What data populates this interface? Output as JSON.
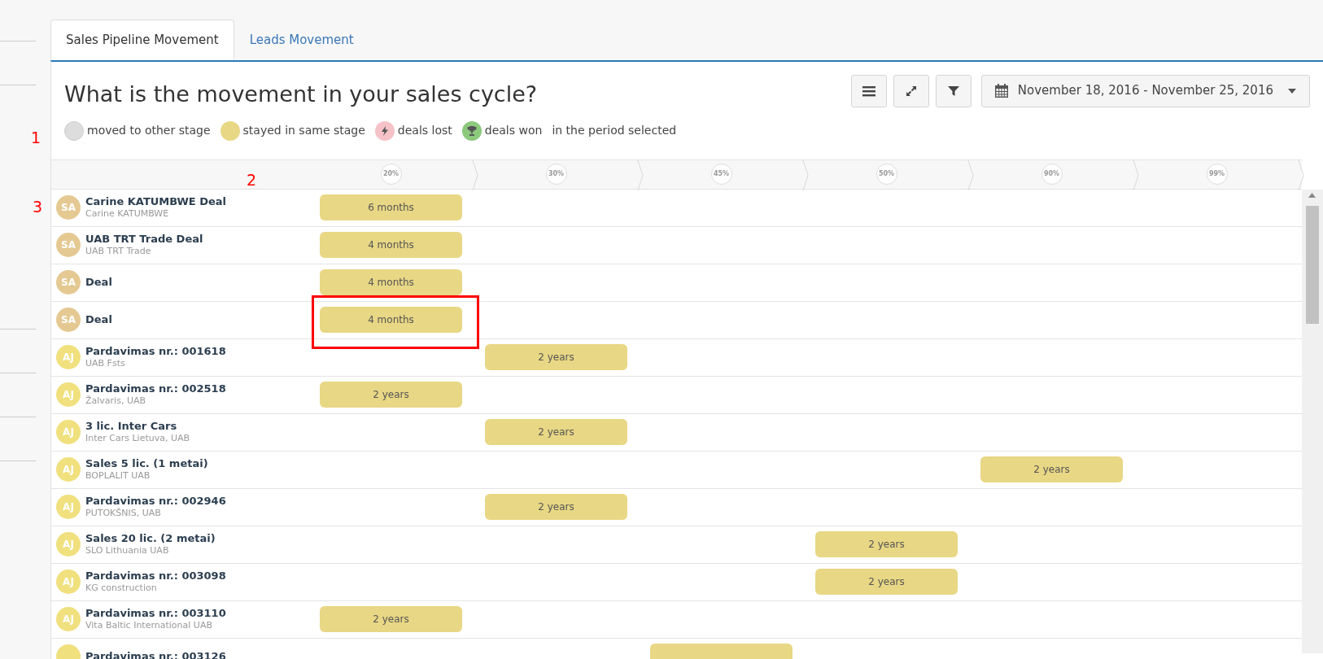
{
  "tabs": [
    {
      "label": "Sales Pipeline Movement",
      "selected": true
    },
    {
      "label": "Leads Movement",
      "selected": false
    }
  ],
  "title": "What is the movement in your sales cycle?",
  "toolbar": {
    "buttons": [
      {
        "kind": "menu"
      },
      {
        "kind": "expand"
      },
      {
        "kind": "filter"
      }
    ],
    "date_range": "November 18, 2016 - November 25, 2016"
  },
  "legend": {
    "items": [
      {
        "kind": "moved",
        "label": "moved to other stage",
        "color": "#dddddd"
      },
      {
        "kind": "stayed",
        "label": "stayed in same stage",
        "color": "#e8d784"
      },
      {
        "kind": "lost",
        "label": "deals lost",
        "color": "#f5c2c7"
      },
      {
        "kind": "won",
        "label": "deals won",
        "color": "#8cc97c"
      }
    ],
    "suffix": "in the period selected"
  },
  "annotations": [
    "1",
    "2",
    "3"
  ],
  "stages": [
    "20%",
    "30%",
    "45%",
    "50%",
    "90%",
    "99%"
  ],
  "rows": [
    {
      "initials": "SA",
      "color": "#e5c992",
      "name": "Carine KATUMBWE Deal",
      "company": "Carine KATUMBWE",
      "highlighted": false,
      "cells": [
        {
          "kind": "stayed",
          "duration": "6 months"
        },
        {
          "kind": "empty"
        },
        {
          "kind": "empty"
        },
        {
          "kind": "empty"
        },
        {
          "kind": "empty"
        },
        {
          "kind": "empty"
        }
      ]
    },
    {
      "initials": "SA",
      "color": "#e5c992",
      "name": "UAB TRT Trade Deal",
      "company": "UAB TRT Trade",
      "highlighted": false,
      "cells": [
        {
          "kind": "stayed",
          "duration": "4 months"
        },
        {
          "kind": "empty"
        },
        {
          "kind": "empty"
        },
        {
          "kind": "empty"
        },
        {
          "kind": "empty"
        },
        {
          "kind": "empty"
        }
      ]
    },
    {
      "initials": "SA",
      "color": "#e5c992",
      "name": "Deal",
      "highlighted": false,
      "cells": [
        {
          "kind": "stayed",
          "duration": "4 months"
        },
        {
          "kind": "empty"
        },
        {
          "kind": "empty"
        },
        {
          "kind": "empty"
        },
        {
          "kind": "empty"
        },
        {
          "kind": "empty"
        }
      ]
    },
    {
      "initials": "SA",
      "color": "#e5c992",
      "name": "Deal",
      "highlighted": true,
      "cells": [
        {
          "kind": "stayed",
          "duration": "4 months"
        },
        {
          "kind": "empty"
        },
        {
          "kind": "empty"
        },
        {
          "kind": "empty"
        },
        {
          "kind": "empty"
        },
        {
          "kind": "empty"
        }
      ]
    },
    {
      "initials": "AJ",
      "color": "#f0e07e",
      "name": "Pardavimas nr.: 001618",
      "company": "UAB Fsts",
      "highlighted": false,
      "cells": [
        {
          "kind": "empty"
        },
        {
          "kind": "stayed",
          "duration": "2 years"
        },
        {
          "kind": "empty"
        },
        {
          "kind": "empty"
        },
        {
          "kind": "empty"
        },
        {
          "kind": "empty"
        }
      ]
    },
    {
      "initials": "AJ",
      "color": "#f0e07e",
      "name": "Pardavimas nr.: 002518",
      "company": "Žalvaris, UAB",
      "highlighted": false,
      "cells": [
        {
          "kind": "stayed",
          "duration": "2 years"
        },
        {
          "kind": "empty"
        },
        {
          "kind": "empty"
        },
        {
          "kind": "empty"
        },
        {
          "kind": "empty"
        },
        {
          "kind": "empty"
        }
      ]
    },
    {
      "initials": "AJ",
      "color": "#f0e07e",
      "name": "3 lic. Inter Cars",
      "company": "Inter Cars Lietuva, UAB",
      "highlighted": false,
      "cells": [
        {
          "kind": "empty"
        },
        {
          "kind": "stayed",
          "duration": "2 years"
        },
        {
          "kind": "empty"
        },
        {
          "kind": "empty"
        },
        {
          "kind": "empty"
        },
        {
          "kind": "empty"
        }
      ]
    },
    {
      "initials": "AJ",
      "color": "#f0e07e",
      "name": "Sales 5 lic. (1 metai)",
      "company": "BOPLALIT UAB",
      "highlighted": false,
      "cells": [
        {
          "kind": "empty"
        },
        {
          "kind": "empty"
        },
        {
          "kind": "empty"
        },
        {
          "kind": "empty"
        },
        {
          "kind": "stayed",
          "duration": "2 years"
        },
        {
          "kind": "empty"
        }
      ]
    },
    {
      "initials": "AJ",
      "color": "#f0e07e",
      "name": "Pardavimas nr.: 002946",
      "company": "PUTOKŠNIS, UAB",
      "highlighted": false,
      "cells": [
        {
          "kind": "empty"
        },
        {
          "kind": "stayed",
          "duration": "2 years"
        },
        {
          "kind": "empty"
        },
        {
          "kind": "empty"
        },
        {
          "kind": "empty"
        },
        {
          "kind": "empty"
        }
      ]
    },
    {
      "initials": "AJ",
      "color": "#f0e07e",
      "name": "Sales 20 lic. (2 metai)",
      "company": "SLO Lithuania UAB",
      "highlighted": false,
      "cells": [
        {
          "kind": "empty"
        },
        {
          "kind": "empty"
        },
        {
          "kind": "empty"
        },
        {
          "kind": "stayed",
          "duration": "2 years"
        },
        {
          "kind": "empty"
        },
        {
          "kind": "empty"
        }
      ]
    },
    {
      "initials": "AJ",
      "color": "#f0e07e",
      "name": "Pardavimas nr.: 003098",
      "company": "KG construction",
      "highlighted": false,
      "cells": [
        {
          "kind": "empty"
        },
        {
          "kind": "empty"
        },
        {
          "kind": "empty"
        },
        {
          "kind": "stayed",
          "duration": "2 years"
        },
        {
          "kind": "empty"
        },
        {
          "kind": "empty"
        }
      ]
    },
    {
      "initials": "AJ",
      "color": "#f0e07e",
      "name": "Pardavimas nr.: 003110",
      "company": "Vita Baltic International UAB",
      "highlighted": false,
      "cells": [
        {
          "kind": "stayed",
          "duration": "2 years"
        },
        {
          "kind": "empty"
        },
        {
          "kind": "empty"
        },
        {
          "kind": "empty"
        },
        {
          "kind": "empty"
        },
        {
          "kind": "empty"
        }
      ]
    },
    {
      "color": "#f0e07e",
      "name": "Pardavimas nr.: 003126",
      "highlighted": false,
      "cells": [
        {
          "kind": "empty"
        },
        {
          "kind": "empty"
        },
        {
          "kind": "stayed"
        },
        {
          "kind": "empty"
        },
        {
          "kind": "empty"
        },
        {
          "kind": "empty"
        }
      ]
    }
  ]
}
